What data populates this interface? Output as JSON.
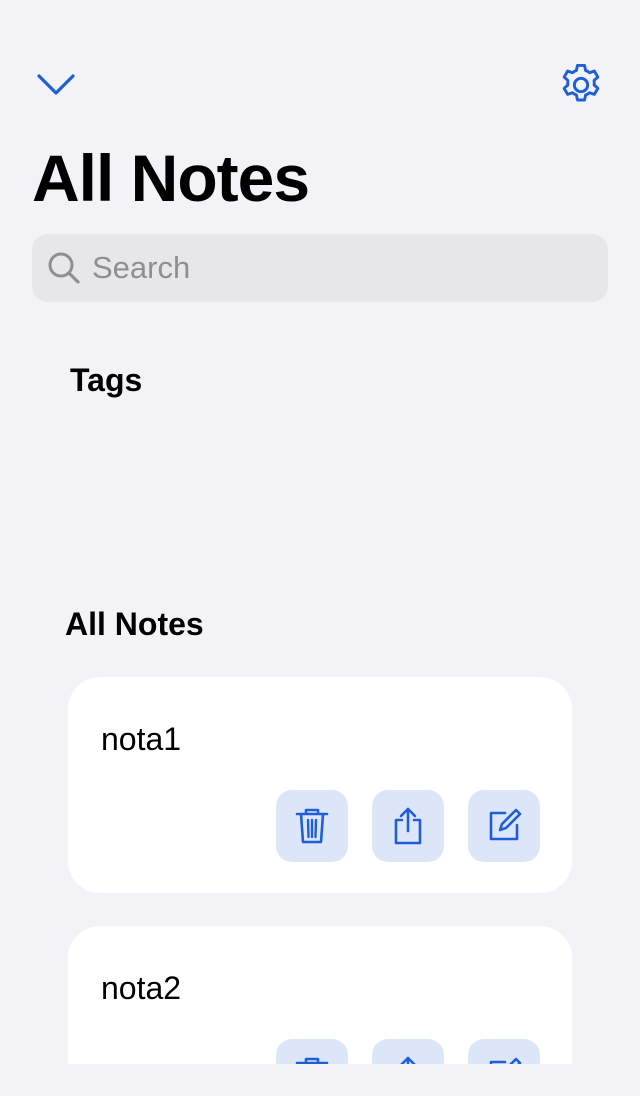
{
  "header": {
    "title": "All Notes"
  },
  "search": {
    "placeholder": "Search",
    "value": ""
  },
  "sections": {
    "tags_title": "Tags",
    "notes_title": "All Notes"
  },
  "notes": [
    {
      "name": "nota1"
    },
    {
      "name": "nota2"
    }
  ],
  "colors": {
    "accent": "#1f5fd6",
    "background": "#f2f2f7",
    "action_bg": "#dde6f9",
    "search_bg": "#e6e6eb"
  },
  "icons": {
    "collapse": "chevron-down-icon",
    "settings": "gear-icon",
    "search": "search-icon",
    "delete": "trash-icon",
    "share": "share-icon",
    "edit": "edit-icon"
  }
}
